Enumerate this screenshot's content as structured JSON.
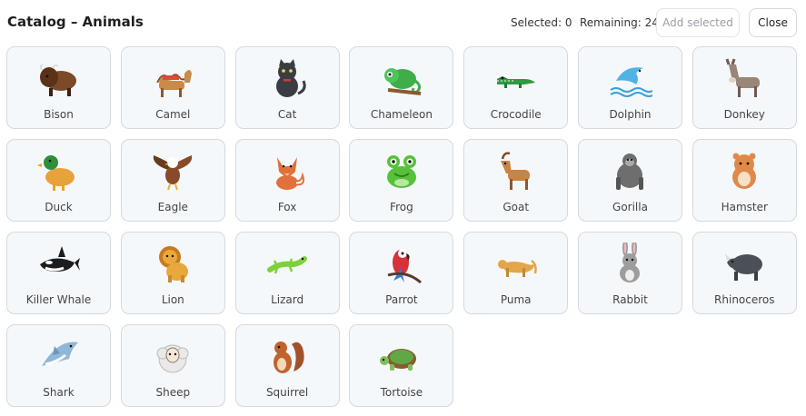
{
  "header": {
    "title": "Catalog – Animals",
    "selected_text": "Selected: 0",
    "remaining_text": "Remaining: 24",
    "add_selected_label": "Add selected",
    "close_label": "Close"
  },
  "animals": [
    {
      "label": "Bison",
      "icon": "bison-icon",
      "color": "#7a4a2a"
    },
    {
      "label": "Camel",
      "icon": "camel-icon",
      "color": "#c98a4a"
    },
    {
      "label": "Cat",
      "icon": "cat-icon",
      "color": "#3a3d44"
    },
    {
      "label": "Chameleon",
      "icon": "chameleon-icon",
      "color": "#3fae49"
    },
    {
      "label": "Crocodile",
      "icon": "crocodile-icon",
      "color": "#2f9a3f"
    },
    {
      "label": "Dolphin",
      "icon": "dolphin-icon",
      "color": "#4fb3e6"
    },
    {
      "label": "Donkey",
      "icon": "donkey-icon",
      "color": "#9a8577"
    },
    {
      "label": "Duck",
      "icon": "duck-icon",
      "color": "#e8a23b"
    },
    {
      "label": "Eagle",
      "icon": "eagle-icon",
      "color": "#8a4a2a"
    },
    {
      "label": "Fox",
      "icon": "fox-icon",
      "color": "#e0713a"
    },
    {
      "label": "Frog",
      "icon": "frog-icon",
      "color": "#56c23b"
    },
    {
      "label": "Goat",
      "icon": "goat-icon",
      "color": "#c88444"
    },
    {
      "label": "Gorilla",
      "icon": "gorilla-icon",
      "color": "#6e6e6e"
    },
    {
      "label": "Hamster",
      "icon": "hamster-icon",
      "color": "#e08a4a"
    },
    {
      "label": "Killer Whale",
      "icon": "killer-whale-icon",
      "color": "#1d1d1d"
    },
    {
      "label": "Lion",
      "icon": "lion-icon",
      "color": "#e8a83b"
    },
    {
      "label": "Lizard",
      "icon": "lizard-icon",
      "color": "#7dd13b"
    },
    {
      "label": "Parrot",
      "icon": "parrot-icon",
      "color": "#d8313a"
    },
    {
      "label": "Puma",
      "icon": "puma-icon",
      "color": "#e3a64a"
    },
    {
      "label": "Rabbit",
      "icon": "rabbit-icon",
      "color": "#9d9d9d"
    },
    {
      "label": "Rhinoceros",
      "icon": "rhinoceros-icon",
      "color": "#4b4f56"
    },
    {
      "label": "Shark",
      "icon": "shark-icon",
      "color": "#8fb8d8"
    },
    {
      "label": "Sheep",
      "icon": "sheep-icon",
      "color": "#e9e9e9"
    },
    {
      "label": "Squirrel",
      "icon": "squirrel-icon",
      "color": "#c0642e"
    },
    {
      "label": "Tortoise",
      "icon": "tortoise-icon",
      "color": "#5fa843"
    }
  ]
}
